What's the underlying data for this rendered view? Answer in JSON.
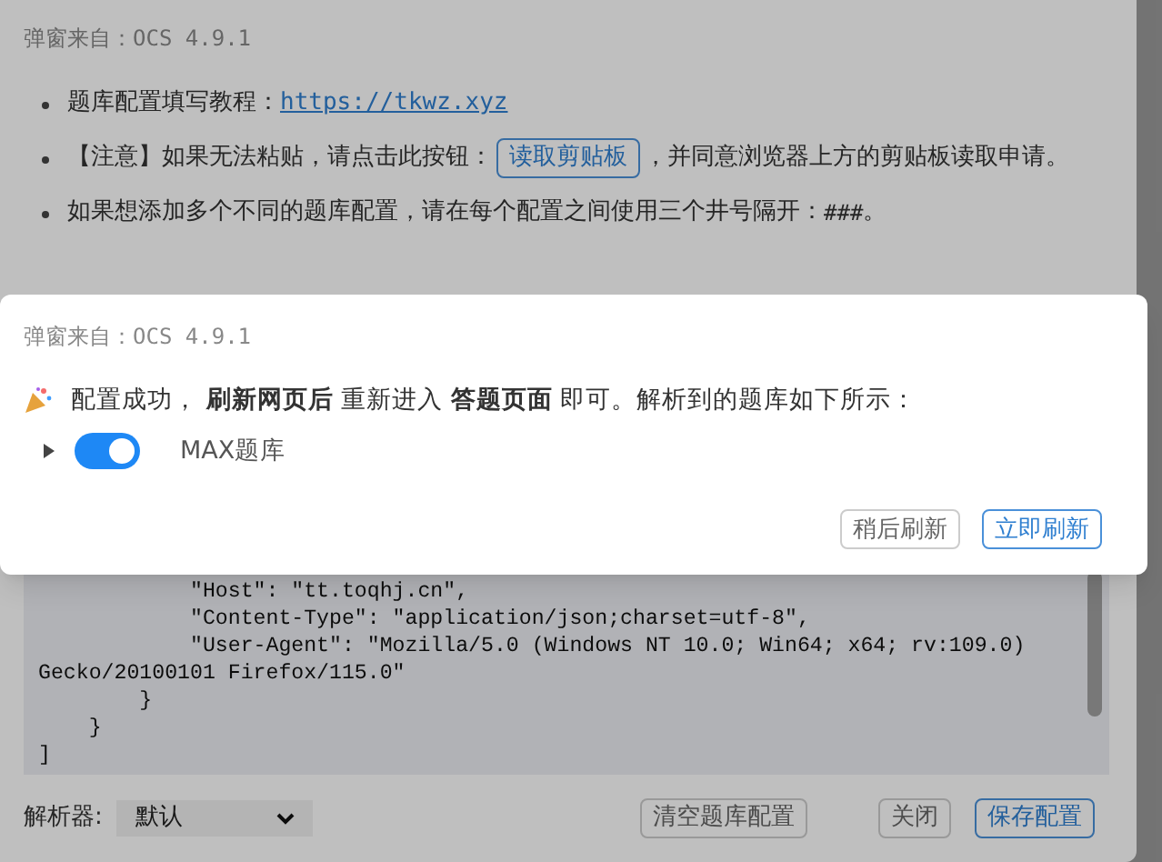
{
  "background_dialog": {
    "title": "弹窗来自：OCS 4.9.1",
    "notes": [
      [
        {
          "kind": "text",
          "text": "题库配置填写教程："
        },
        {
          "kind": "link",
          "text": "https://tkwz.xyz"
        }
      ],
      [
        {
          "kind": "text",
          "text": "【注意】如果无法粘贴，请点击此按钮："
        },
        {
          "kind": "button",
          "text": "读取剪贴板"
        },
        {
          "kind": "text",
          "text": "，并同意浏览器上方的剪贴板读取申"
        },
        {
          "kind": "text",
          "text": "请。"
        }
      ],
      [
        {
          "kind": "text",
          "text": "如果想添加多个不同的题库配置，请在每个配置之间使用三个井号隔开："
        },
        {
          "kind": "code",
          "text": "###"
        },
        {
          "kind": "text",
          "text": "。"
        }
      ]
    ],
    "code_lines": [
      "            \"Host\": \"tt.toqhj.cn\",",
      "            \"Content-Type\": \"application/json;charset=utf-8\",",
      "            \"User-Agent\": \"Mozilla/5.0 (Windows NT 10.0; Win64; x64; rv:109.0)",
      "Gecko/20100101 Firefox/115.0\"",
      "        }",
      "    }",
      "]"
    ],
    "parser": {
      "label": "解析器:",
      "value": "默认"
    },
    "buttons": [
      {
        "label": "清空题库配置",
        "kind": "plain"
      },
      {
        "label": "关闭",
        "kind": "plain"
      },
      {
        "label": "保存配置",
        "kind": "primary"
      }
    ]
  },
  "modal": {
    "title": "弹窗来自：OCS 4.9.1",
    "message": "配置成功， **刷新网页后** 重新进入 **答题页面** 即可。解析到的题库如下所示：",
    "banks": [
      {
        "label": "MAX题库",
        "on": true,
        "expanded": false
      }
    ],
    "buttons": [
      {
        "label": "稍后刷新",
        "kind": "plain"
      },
      {
        "label": "立即刷新",
        "kind": "primary"
      }
    ]
  }
}
